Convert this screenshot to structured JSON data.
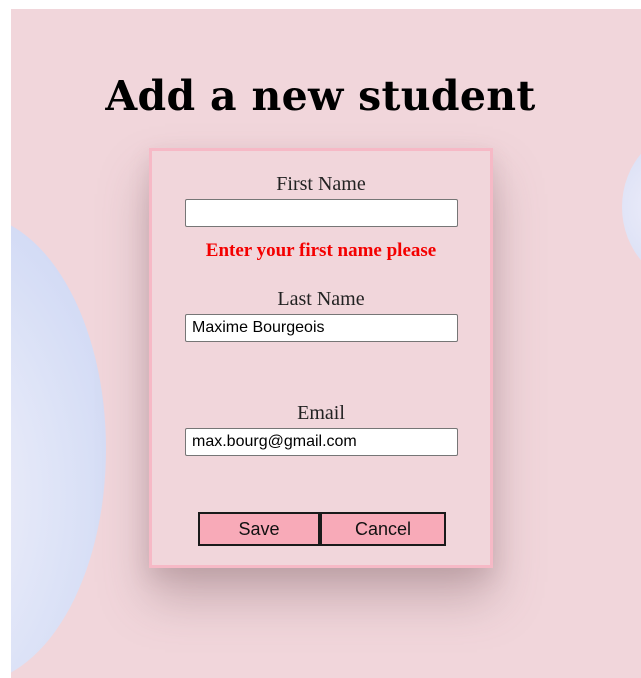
{
  "page": {
    "title": "Add a new student"
  },
  "form": {
    "first_name": {
      "label": "First Name",
      "value": "",
      "error": "Enter your first name please"
    },
    "last_name": {
      "label": "Last Name",
      "value": "Maxime Bourgeois"
    },
    "email": {
      "label": "Email",
      "value": "max.bourg@gmail.com"
    },
    "buttons": {
      "save_label": "Save",
      "cancel_label": "Cancel"
    }
  },
  "colors": {
    "background": "#f1d6db",
    "card_border": "#f6b9c6",
    "error": "#f40000",
    "button_fill": "#f8aab8"
  }
}
